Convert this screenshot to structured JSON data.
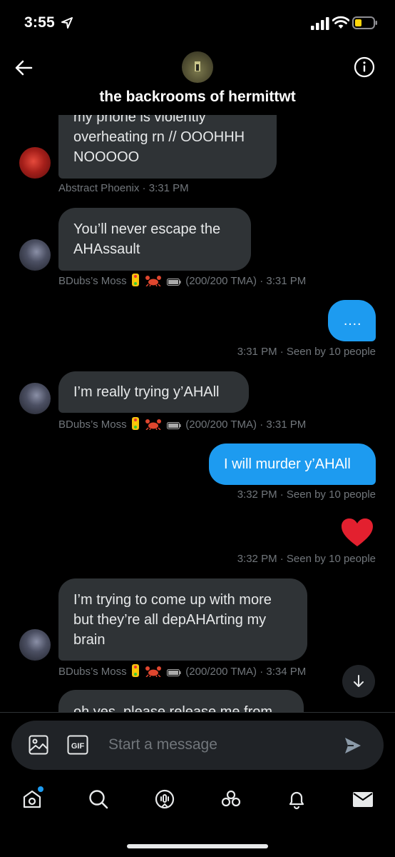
{
  "status_bar": {
    "time": "3:55"
  },
  "header": {
    "title": "the backrooms of hermittwt"
  },
  "messages": [
    {
      "lines": [
        "my phone is violently",
        "overheating rn // OOOHHH",
        "NOOOOO"
      ],
      "meta": "Abstract Phoenix · 3:31 PM"
    },
    {
      "lines": [
        "You’ll never escape the",
        "AHAssault"
      ],
      "meta_name": "BDubs’s Moss",
      "meta_rest": "(200/200 TMA) · 3:31 PM"
    },
    {
      "lines": [
        "…."
      ],
      "meta": "3:31 PM · Seen by 10 people"
    },
    {
      "lines": [
        "I’m really trying y’AHAll"
      ],
      "meta_name": "BDubs’s Moss",
      "meta_rest": "(200/200 TMA) · 3:31 PM"
    },
    {
      "lines": [
        "I will murder y’AHAll"
      ],
      "meta": "3:32 PM · Seen by 10 people"
    },
    {
      "emoji": "heart",
      "meta": "3:32 PM · Seen by 10 people"
    },
    {
      "lines": [
        "I’m trying to come up with more",
        "but they’re all depAHArting my",
        "brain"
      ],
      "meta_name": "BDubs’s Moss",
      "meta_rest": "(200/200 TMA) · 3:34 PM"
    },
    {
      "lines": [
        "oh yes, please release me from"
      ]
    }
  ],
  "composer": {
    "placeholder": "Start a message"
  },
  "colors": {
    "accent": "#1d9bf0",
    "bubble_in": "#2f3336",
    "meta": "#71767b"
  }
}
